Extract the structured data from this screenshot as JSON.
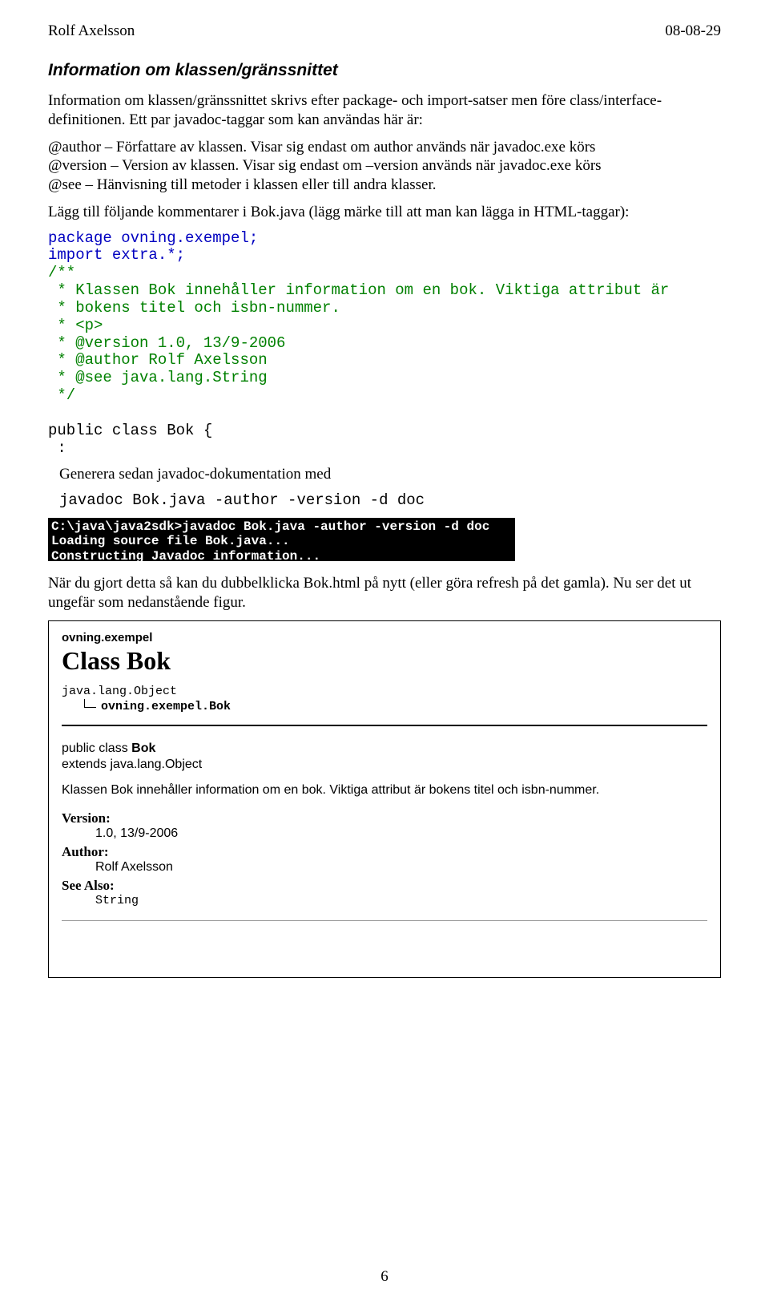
{
  "header": {
    "author": "Rolf Axelsson",
    "date": "08-08-29"
  },
  "section_title": "Information om klassen/gränssnittet",
  "para1": "Information om klassen/gränssnittet skrivs efter package- och import-satser men före class/interface-definitionen. Ett par javadoc-taggar som kan användas här är:",
  "tags": [
    {
      "name": "@author",
      "desc": " – Författare av klassen. Visar sig endast om author används när javadoc.exe körs"
    },
    {
      "name": "@version",
      "desc": " – Version av klassen. Visar sig endast om –version används när javadoc.exe körs"
    },
    {
      "name": "@see",
      "desc": " – Hänvisning till metoder i klassen eller till andra klasser."
    }
  ],
  "para2": "Lägg till följande kommentarer i Bok.java (lägg märke till att man kan lägga in HTML-taggar):",
  "code": {
    "pkg": "package ovning.exempel;",
    "imp": "import extra.*;",
    "doc_open": "/**",
    "doc1": " * Klassen Bok innehåller information om en bok. Viktiga attribut är",
    "doc2": " * bokens titel och isbn-nummer.",
    "doc3": " * <p>",
    "doc4": " * @version 1.0, 13/9-2006",
    "doc5": " * @author Rolf Axelsson",
    "doc6": " * @see java.lang.String",
    "doc_close": " */",
    "cls": "public class Bok {",
    "colon": " :"
  },
  "para3": "Generera sedan javadoc-dokumentation med",
  "cmd": "javadoc Bok.java -author -version -d doc",
  "terminal": "C:\\java\\java2sdk>javadoc Bok.java -author -version -d doc\nLoading source file Bok.java...\nConstructing Javadoc information...",
  "para4": "När du gjort detta så kan du dubbelklicka Bok.html på nytt (eller göra refresh på det gamla). Nu ser det ut ungefär som nedanstående figur.",
  "javadoc": {
    "package": "ovning.exempel",
    "classTitle": "Class Bok",
    "hier_root": "java.lang.Object",
    "hier_child": "ovning.exempel.Bok",
    "sig1_pre": "public class ",
    "sig1_bold": "Bok",
    "sig2": "extends java.lang.Object",
    "desc": "Klassen Bok innehåller information om en bok. Viktiga attribut är bokens titel och isbn-nummer.",
    "version_label": "Version:",
    "version_value": "1.0, 13/9-2006",
    "author_label": "Author:",
    "author_value": "Rolf Axelsson",
    "see_label": "See Also:",
    "see_value": "String"
  },
  "page_number": "6"
}
